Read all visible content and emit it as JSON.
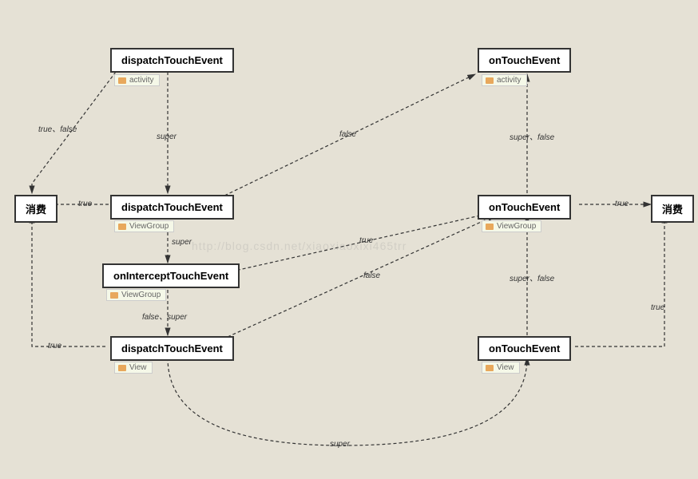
{
  "nodes": {
    "dispatch_activity": {
      "label": "dispatchTouchEvent",
      "badge": "activity"
    },
    "touch_activity": {
      "label": "onTouchEvent",
      "badge": "activity"
    },
    "dispatch_viewgroup": {
      "label": "dispatchTouchEvent",
      "badge": "ViewGroup"
    },
    "intercept_viewgroup": {
      "label": "onInterceptTouchEvent",
      "badge": "ViewGroup"
    },
    "touch_viewgroup": {
      "label": "onTouchEvent",
      "badge": "ViewGroup"
    },
    "dispatch_view": {
      "label": "dispatchTouchEvent",
      "badge": "View"
    },
    "touch_view": {
      "label": "onTouchEvent",
      "badge": "View"
    },
    "consume_left": {
      "label": "消费"
    },
    "consume_right": {
      "label": "消费"
    }
  },
  "edges": {
    "tf1": "true、false",
    "super1": "super",
    "false1": "false",
    "super_false1": "super、false",
    "true1": "true",
    "true2": "true",
    "super2": "super",
    "true3": "true",
    "false2": "false",
    "super_false2": "super、false",
    "false_super": "false、super",
    "true4": "true",
    "true5": "true",
    "super3": "super"
  },
  "watermark": "http://blog.csdn.net/xiaoxiaoxixi465trr"
}
